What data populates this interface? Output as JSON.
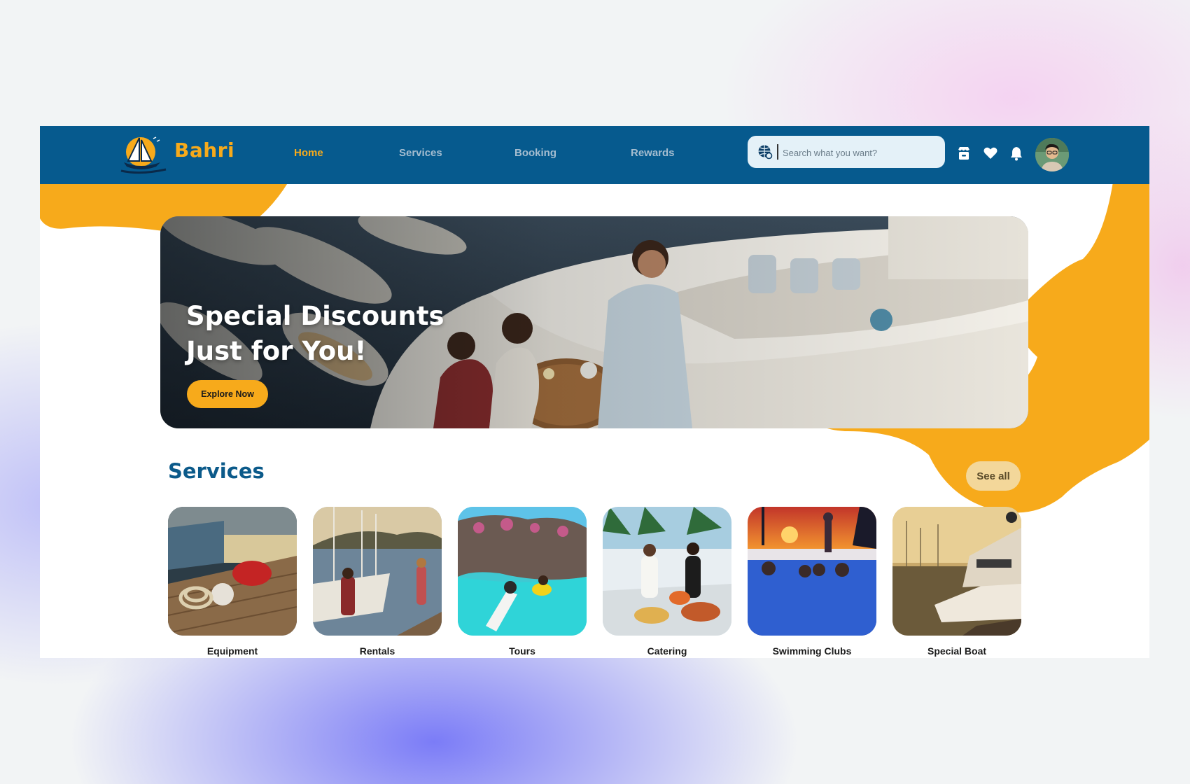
{
  "brand": {
    "name": "Bahri"
  },
  "nav": {
    "home": "Home",
    "services": "Services",
    "booking": "Booking",
    "rewards": "Rewards"
  },
  "search": {
    "placeholder": "Search what you want?"
  },
  "icons": [
    "globe-icon",
    "shop-icon",
    "heart-icon",
    "bell-icon"
  ],
  "hero": {
    "line1": "Special Discounts",
    "line2": "Just for You!",
    "cta": "Explore Now"
  },
  "services": {
    "title": "Services",
    "see_all": "See all",
    "items": [
      {
        "label": "Equipment"
      },
      {
        "label": "Rentals"
      },
      {
        "label": "Tours"
      },
      {
        "label": "Catering"
      },
      {
        "label": "Swimming Clubs"
      },
      {
        "label": "Special Boat"
      }
    ]
  },
  "colors": {
    "nav_bg": "#065a8e",
    "accent": "#f7aa1b",
    "section_title": "#0b5a8a"
  }
}
